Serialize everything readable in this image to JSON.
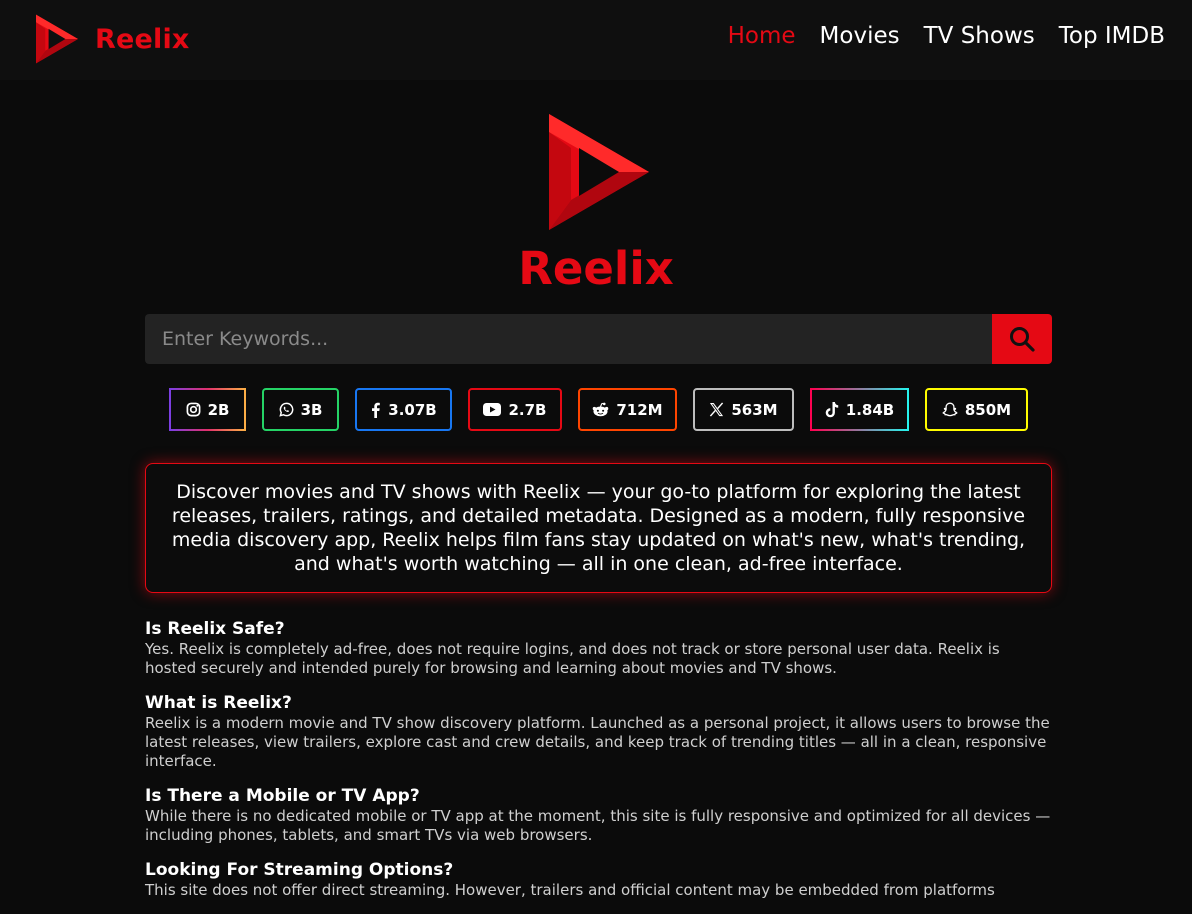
{
  "brand": {
    "name": "Reelix"
  },
  "nav": {
    "items": [
      {
        "label": "Home",
        "active": true
      },
      {
        "label": "Movies",
        "active": false
      },
      {
        "label": "TV Shows",
        "active": false
      },
      {
        "label": "Top IMDB",
        "active": false
      }
    ]
  },
  "hero": {
    "name": "Reelix"
  },
  "search": {
    "placeholder": "Enter Keywords...",
    "value": ""
  },
  "socials": [
    {
      "icon": "instagram-icon",
      "count": "2B"
    },
    {
      "icon": "whatsapp-icon",
      "count": "3B"
    },
    {
      "icon": "facebook-icon",
      "count": "3.07B"
    },
    {
      "icon": "youtube-icon",
      "count": "2.7B"
    },
    {
      "icon": "reddit-icon",
      "count": "712M"
    },
    {
      "icon": "x-icon",
      "count": "563M"
    },
    {
      "icon": "tiktok-icon",
      "count": "1.84B"
    },
    {
      "icon": "snapchat-icon",
      "count": "850M"
    }
  ],
  "about": {
    "text": "Discover movies and TV shows with Reelix — your go-to platform for exploring the latest releases, trailers, ratings, and detailed metadata. Designed as a modern, fully responsive media discovery app, Reelix helps film fans stay updated on what's new, what's trending, and what's worth watching — all in one clean, ad-free interface."
  },
  "faq": [
    {
      "q": "Is Reelix Safe?",
      "a": "Yes. Reelix is completely ad-free, does not require logins, and does not track or store personal user data. Reelix is hosted securely and intended purely for browsing and learning about movies and TV shows."
    },
    {
      "q": "What is Reelix?",
      "a": "Reelix is a modern movie and TV show discovery platform. Launched as a personal project, it allows users to browse the latest releases, view trailers, explore cast and crew details, and keep track of trending titles — all in a clean, responsive interface."
    },
    {
      "q": "Is There a Mobile or TV App?",
      "a": "While there is no dedicated mobile or TV app at the moment, this site is fully responsive and optimized for all devices — including phones, tablets, and smart TVs via web browsers."
    },
    {
      "q": "Looking For Streaming Options?",
      "a": "This site does not offer direct streaming. However, trailers and official content may be embedded from platforms"
    }
  ],
  "colors": {
    "accent": "#e50914",
    "background": "#0b0b0b",
    "topbar": "#0f0f0f",
    "input": "#232323"
  }
}
